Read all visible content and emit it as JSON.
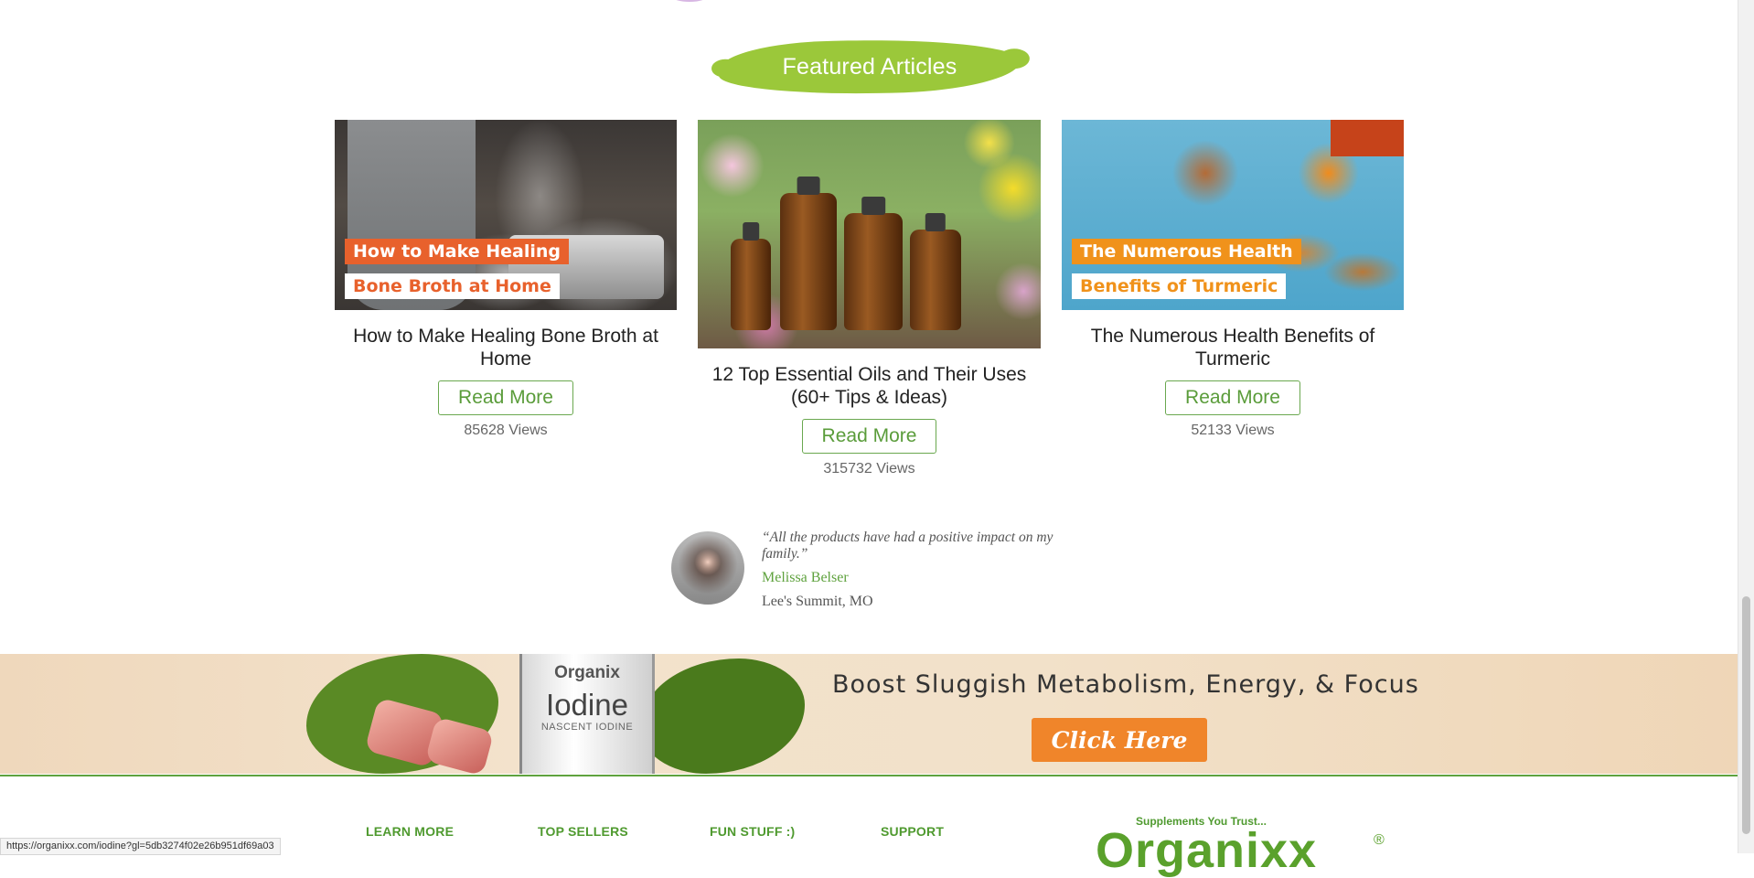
{
  "section": {
    "title": "Featured Articles"
  },
  "articles": [
    {
      "image_label_1": "How to Make Healing",
      "image_label_2": "Bone Broth at Home",
      "title": "How to Make Healing Bone Broth at Home",
      "button": "Read More",
      "views": "85628 Views"
    },
    {
      "title": "12 Top Essential Oils and Their Uses (60+ Tips & Ideas)",
      "button": "Read More",
      "views": "315732 Views"
    },
    {
      "image_label_1": "The Numerous Health",
      "image_label_2": "Benefits of Turmeric",
      "title": "The Numerous Health Benefits of Turmeric",
      "button": "Read More",
      "views": "52133 Views"
    }
  ],
  "testimonial": {
    "quote": "“All the products have had a positive impact on my family.”",
    "name": "Melissa Belser",
    "location": "Lee's Summit, MO"
  },
  "banner": {
    "product_brand": "Organix",
    "product_name": "Iodine",
    "product_sub": "NASCENT IODINE",
    "headline": "Boost Sluggish Metabolism, Energy, & Focus",
    "cta": "Click Here"
  },
  "footer": {
    "links": [
      "LEARN MORE",
      "TOP SELLERS",
      "FUN STUFF :)",
      "SUPPORT"
    ],
    "logo_tagline": "Supplements You Trust...",
    "logo_text": "Organixx",
    "logo_reg": "®"
  },
  "status_bar": {
    "url": "https://organixx.com/iodine?gl=5db3274f02e26b951df69a03"
  },
  "colors": {
    "brand_green": "#5fa23e",
    "heading_green": "#9bc83a",
    "cta_orange": "#f0852a"
  }
}
